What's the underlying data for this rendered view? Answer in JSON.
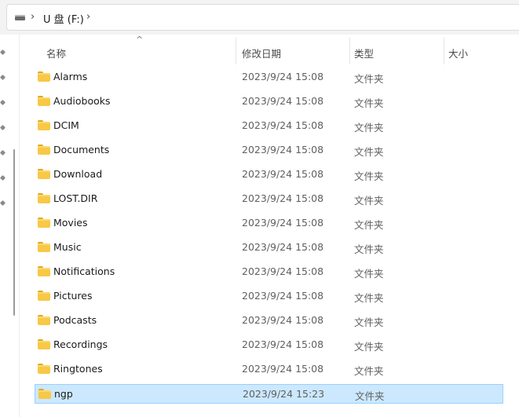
{
  "address_bar": {
    "path": [
      "U 盘 (F:)"
    ],
    "separator": "›",
    "drive_icon": "usb-drive-icon"
  },
  "columns": {
    "name": "名称",
    "modified": "修改日期",
    "type": "类型",
    "size": "大小",
    "sort_indicator": "^"
  },
  "files": [
    {
      "name": "Alarms",
      "modified": "2023/9/24 15:08",
      "type": "文件夹",
      "icon": "folder-icon"
    },
    {
      "name": "Audiobooks",
      "modified": "2023/9/24 15:08",
      "type": "文件夹",
      "icon": "folder-icon"
    },
    {
      "name": "DCIM",
      "modified": "2023/9/24 15:08",
      "type": "文件夹",
      "icon": "folder-icon"
    },
    {
      "name": "Documents",
      "modified": "2023/9/24 15:08",
      "type": "文件夹",
      "icon": "folder-icon"
    },
    {
      "name": "Download",
      "modified": "2023/9/24 15:08",
      "type": "文件夹",
      "icon": "folder-icon"
    },
    {
      "name": "LOST.DIR",
      "modified": "2023/9/24 15:08",
      "type": "文件夹",
      "icon": "folder-icon"
    },
    {
      "name": "Movies",
      "modified": "2023/9/24 15:08",
      "type": "文件夹",
      "icon": "folder-icon"
    },
    {
      "name": "Music",
      "modified": "2023/9/24 15:08",
      "type": "文件夹",
      "icon": "folder-icon"
    },
    {
      "name": "Notifications",
      "modified": "2023/9/24 15:08",
      "type": "文件夹",
      "icon": "folder-icon"
    },
    {
      "name": "Pictures",
      "modified": "2023/9/24 15:08",
      "type": "文件夹",
      "icon": "folder-icon"
    },
    {
      "name": "Podcasts",
      "modified": "2023/9/24 15:08",
      "type": "文件夹",
      "icon": "folder-icon"
    },
    {
      "name": "Recordings",
      "modified": "2023/9/24 15:08",
      "type": "文件夹",
      "icon": "folder-icon"
    },
    {
      "name": "Ringtones",
      "modified": "2023/9/24 15:08",
      "type": "文件夹",
      "icon": "folder-icon"
    },
    {
      "name": "ngp",
      "modified": "2023/9/24 15:23",
      "type": "文件夹",
      "icon": "folder-icon",
      "selected": true
    }
  ],
  "colors": {
    "selection_bg": "#cce8ff",
    "selection_border": "#99d1ff",
    "folder": "#f8c846"
  }
}
